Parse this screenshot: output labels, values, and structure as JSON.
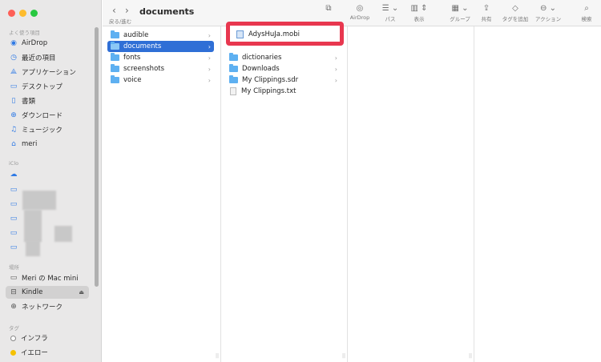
{
  "window": {
    "title": "documents"
  },
  "toolbar": {
    "nav_label": "戻る/進む",
    "buttons": [
      {
        "label": "",
        "icon": "folder-action-icon"
      },
      {
        "label": "AirDrop",
        "icon": "airdrop-icon"
      },
      {
        "label": "パス",
        "icon": "list-path-icon"
      },
      {
        "label": "表示",
        "icon": "columns-view-icon"
      },
      {
        "label": "グループ",
        "icon": "grid-group-icon"
      },
      {
        "label": "共有",
        "icon": "share-icon"
      },
      {
        "label": "タグを追加",
        "icon": "tag-icon"
      },
      {
        "label": "アクション",
        "icon": "ellipsis-circle-icon"
      },
      {
        "label": "検索",
        "icon": "search-icon"
      }
    ]
  },
  "sidebar": {
    "favorites_header": "よく使う項目",
    "favorites": [
      {
        "label": "AirDrop",
        "icon": "airdrop-icon"
      },
      {
        "label": "最近の項目",
        "icon": "clock-icon"
      },
      {
        "label": "アプリケーション",
        "icon": "applications-icon"
      },
      {
        "label": "デスクトップ",
        "icon": "desktop-icon"
      },
      {
        "label": "書類",
        "icon": "document-icon"
      },
      {
        "label": "ダウンロード",
        "icon": "download-icon"
      },
      {
        "label": "ミュージック",
        "icon": "music-icon"
      },
      {
        "label": "meri",
        "icon": "home-icon"
      }
    ],
    "icloud_header": "iClo",
    "locations_header": "場所",
    "locations": [
      {
        "label": "Meri の Mac mini",
        "icon": "computer-icon"
      },
      {
        "label": "Kindle",
        "icon": "drive-icon"
      },
      {
        "label": "ネットワーク",
        "icon": "network-icon"
      }
    ],
    "tags_header": "タグ",
    "tags": [
      {
        "label": "インフラ",
        "color": "#ffffff"
      },
      {
        "label": "イエロー",
        "color": "#f5c100"
      }
    ]
  },
  "columns": {
    "col1": [
      "audible",
      "documents",
      "fonts",
      "screenshots",
      "voice"
    ],
    "col2": [
      {
        "name": "AdysHuJa.mobi",
        "type": "mobi",
        "folder": false
      },
      {
        "name": "dictionaries",
        "folder": true
      },
      {
        "name": "Downloads",
        "folder": true
      },
      {
        "name": "My Clippings.sdr",
        "folder": true
      },
      {
        "name": "My Clippings.txt",
        "folder": false
      }
    ]
  },
  "colors": {
    "selection": "#2f6fd6",
    "highlight": "#e8374f",
    "folder": "#5eb0f1"
  }
}
